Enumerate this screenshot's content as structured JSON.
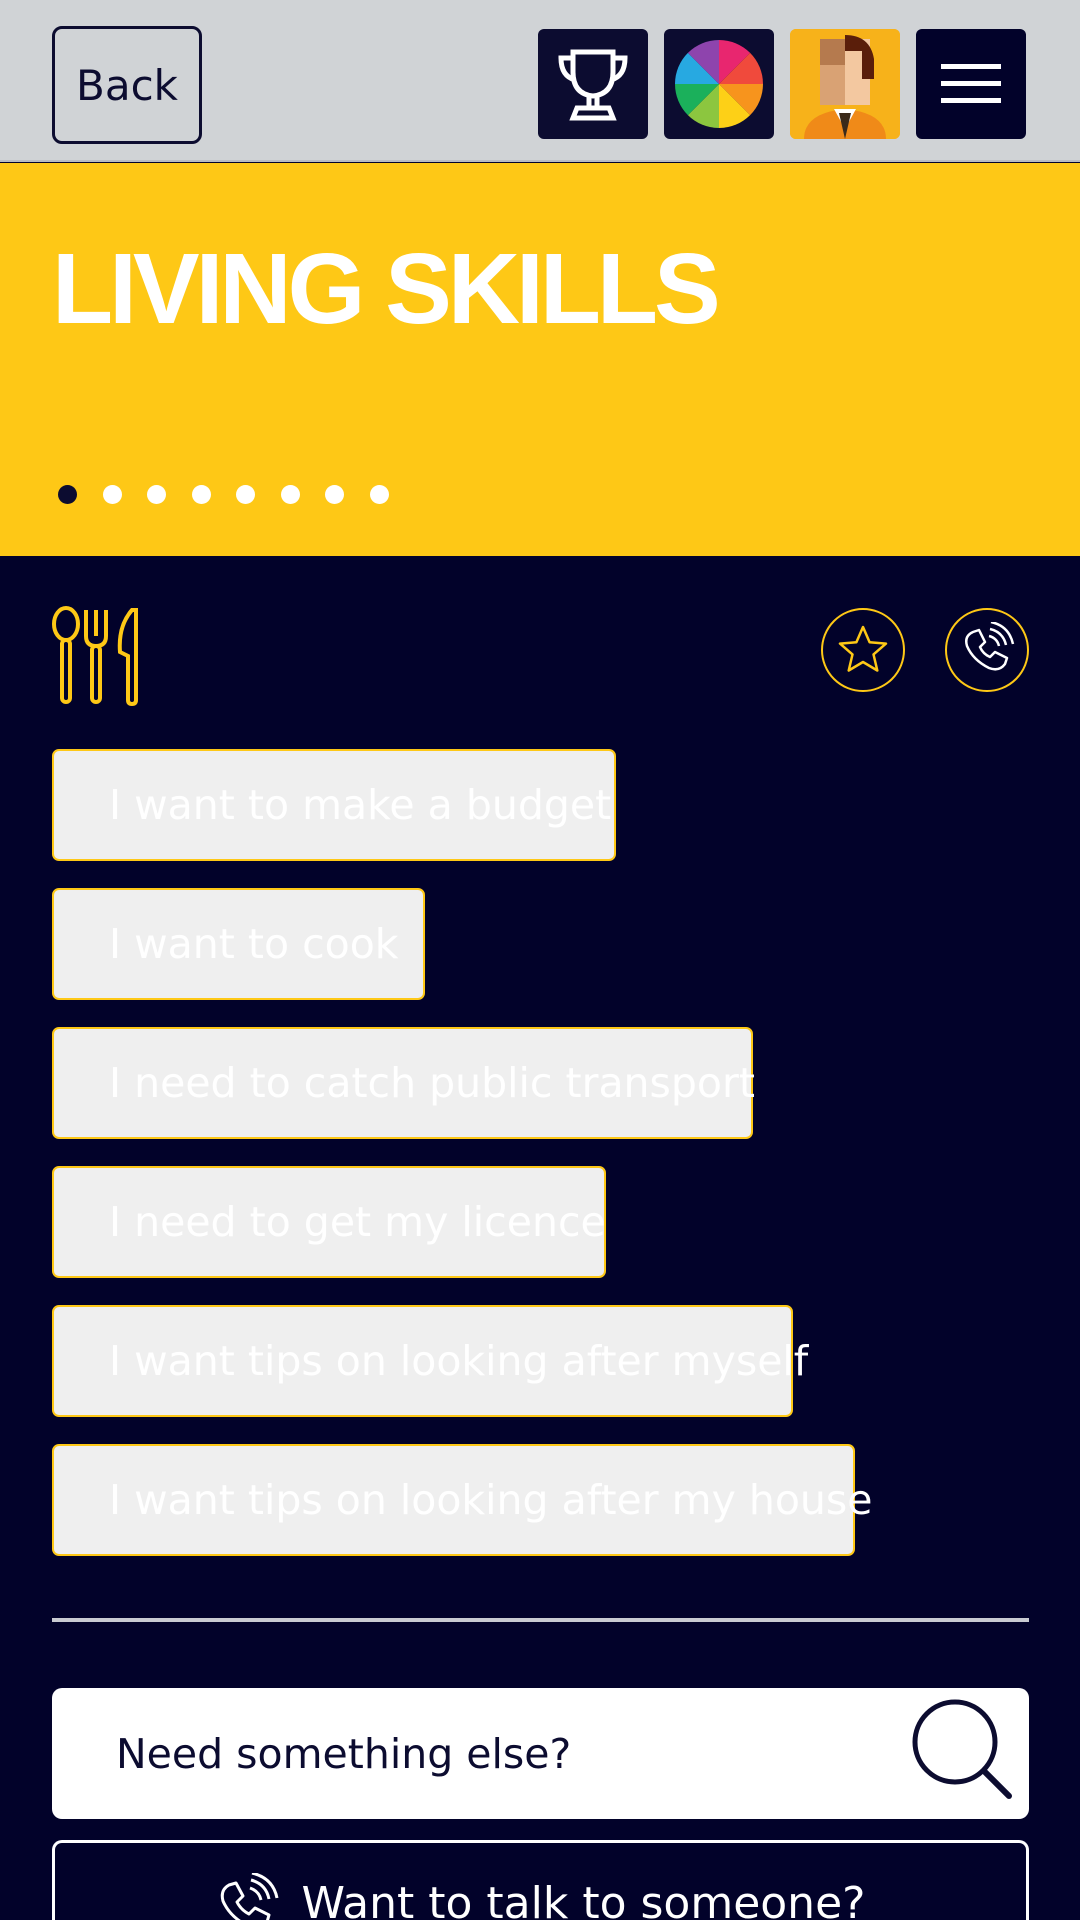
{
  "header": {
    "back_label": "Back",
    "icons": [
      "trophy-icon",
      "colour-wheel-icon",
      "avatar-icon",
      "menu-icon"
    ]
  },
  "hero": {
    "title": "LIVING SKILLS",
    "pager": {
      "total": 8,
      "active": 1
    }
  },
  "section": {
    "icon": "cutlery-icon",
    "actions": [
      "star-icon",
      "phone-icon"
    ]
  },
  "options": [
    {
      "label": "I want to make a budget"
    },
    {
      "label": "I want to cook"
    },
    {
      "label": "I need to catch public transport"
    },
    {
      "label": "I need to get my licence"
    },
    {
      "label": "I want tips on looking after myself"
    },
    {
      "label": "I want tips on looking after my house"
    }
  ],
  "search": {
    "placeholder": "Need something else?"
  },
  "talk": {
    "label": "Want to talk to someone?"
  },
  "colors": {
    "accent": "#fec816",
    "navy": "#02022a",
    "header_bg": "#d0d3d6"
  }
}
